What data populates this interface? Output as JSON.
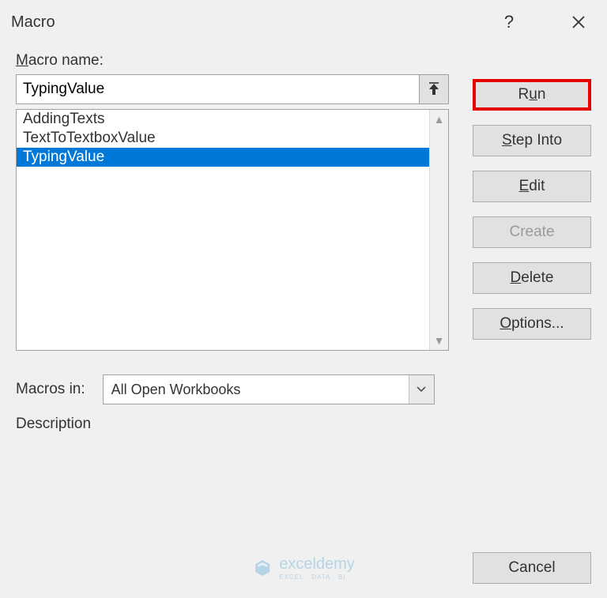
{
  "window": {
    "title": "Macro"
  },
  "labels": {
    "macro_name_pre": "M",
    "macro_name_rest": "acro name:",
    "macros_in": "Macros in:",
    "description": "Description"
  },
  "input": {
    "value": "TypingValue"
  },
  "list": {
    "items": [
      "AddingTexts",
      "TextToTextboxValue",
      "TypingValue"
    ],
    "selected_index": 2
  },
  "buttons": {
    "run_pre": "R",
    "run_mid": "u",
    "run_rest": "n",
    "stepinto_pre": "",
    "stepinto_u": "S",
    "stepinto_rest": "tep Into",
    "edit_pre": "",
    "edit_u": "E",
    "edit_rest": "dit",
    "create": "Create",
    "delete_pre": "",
    "delete_u": "D",
    "delete_rest": "elete",
    "options_pre": "",
    "options_u": "O",
    "options_rest": "ptions...",
    "cancel": "Cancel"
  },
  "select": {
    "value": "All Open Workbooks"
  },
  "watermark": {
    "text": "exceldemy",
    "sub": "EXCEL · DATA · BI"
  }
}
